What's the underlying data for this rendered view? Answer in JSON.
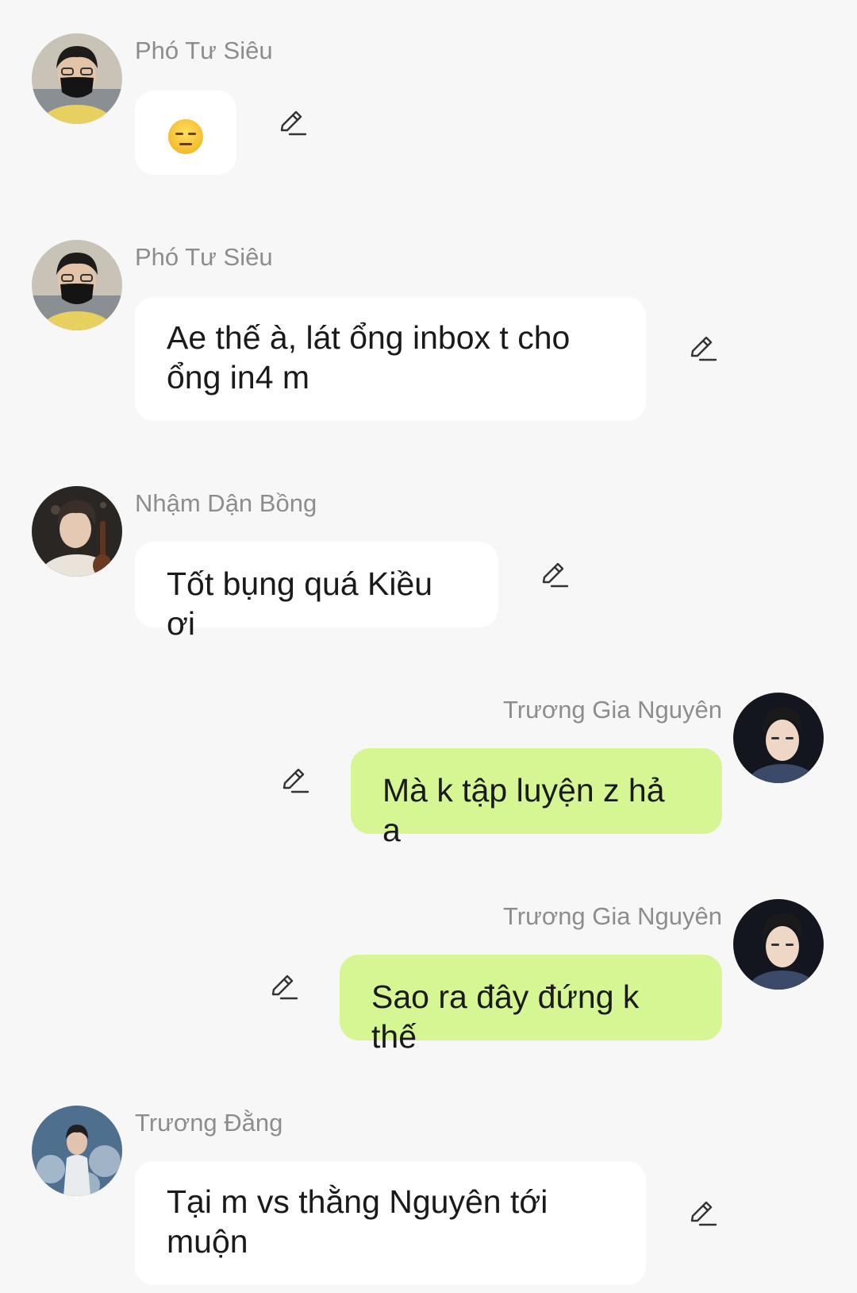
{
  "messages": [
    {
      "sender": "Phó Tư Siêu",
      "text": "😑",
      "emoji": "expressionless-face"
    },
    {
      "sender": "Phó Tư Siêu",
      "text": "Ae thế à, lát ổng inbox t cho ổng in4 m"
    },
    {
      "sender": "Nhậm Dận Bồng",
      "text": "Tốt bụng quá Kiều ơi"
    },
    {
      "sender": "Trương Gia Nguyên",
      "text": "Mà k tập luyện z hả a"
    },
    {
      "sender": "Trương Gia Nguyên",
      "text": "Sao ra đây đứng k thế"
    },
    {
      "sender": "Trương Đằng",
      "text": "Tại m vs thằng Nguyên tới muộn"
    }
  ],
  "colors": {
    "background": "#f7f7f7",
    "incoming_bubble": "#ffffff",
    "outgoing_bubble": "#d5f692",
    "sender_name": "#8d8d8d",
    "message_text": "#1a1a1a"
  }
}
